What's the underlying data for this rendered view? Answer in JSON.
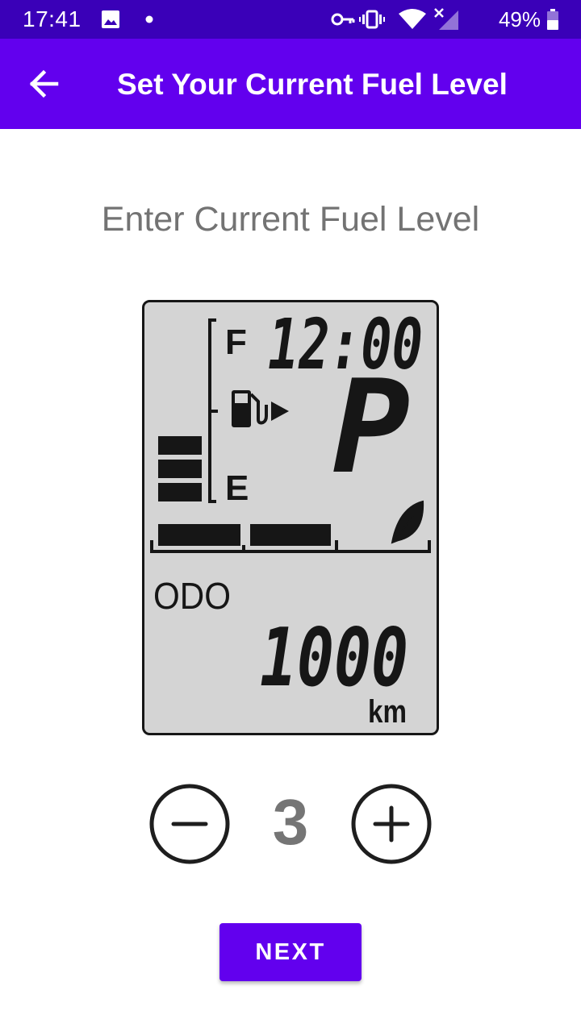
{
  "status_bar": {
    "time": "17:41",
    "battery_percent": "49%",
    "icons": [
      "image-icon",
      "notification-dot-icon",
      "vpn-key-icon",
      "vibrate-icon",
      "wifi-icon",
      "no-signal-icon",
      "battery-icon"
    ]
  },
  "app_bar": {
    "title": "Set Your Current Fuel Level",
    "back_icon": "arrow-back-icon"
  },
  "heading": "Enter Current Fuel Level",
  "display": {
    "full_marker": "F",
    "empty_marker": "E",
    "clock": "12:00",
    "gear": "P",
    "odo_label": "ODO",
    "odometer": "1000",
    "unit": "km",
    "fuel_icon": "fuel-pump-icon",
    "eco_icon": "leaf-icon"
  },
  "fuel_level": {
    "value": "3",
    "bars_filled": 3,
    "bars_total": 8
  },
  "next_button": "NEXT",
  "colors": {
    "status_bar": "#3a00b8",
    "primary": "#6200ee",
    "lcd_background": "#d4d4d4",
    "lcd_segment": "#161616",
    "heading_text": "#737373"
  }
}
